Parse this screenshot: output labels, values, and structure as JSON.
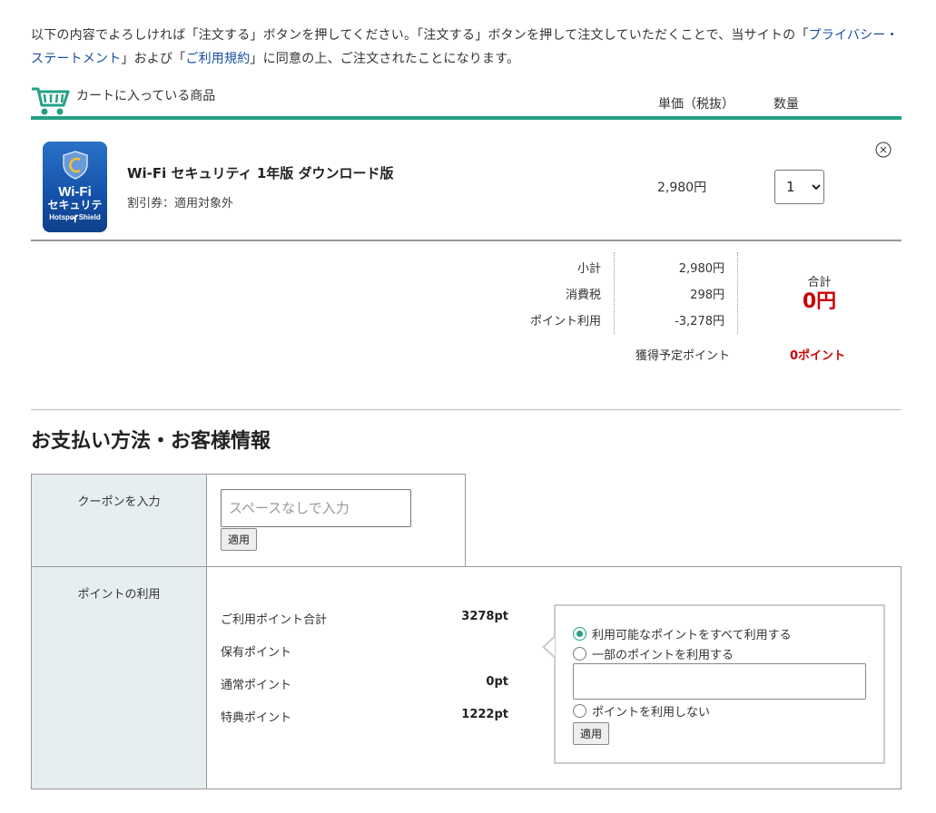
{
  "notice": {
    "part1": "以下の内容でよろしければ「注文する」ボタンを押してください。「注文する」ボタンを押して注文していただくことで、当サイトの",
    "bracket_open1": "「",
    "privacy_link": "プライバシー・ステートメント",
    "bracket_close1": "」および「",
    "terms_link": "ご利用規約",
    "part2": "」に同意の上、ご注文されたことになります。"
  },
  "cart": {
    "title": "カートに入っている商品",
    "col_price": "単価（税抜）",
    "col_qty": "数量",
    "accent_color": "#24a085"
  },
  "item": {
    "image_text1": "Wi-Fi",
    "image_text2": "セキュリティ",
    "image_text3": "Hotspot Shield",
    "name": "Wi-Fi セキュリティ 1年版 ダウンロード版",
    "coupon": "割引券：適用対象外",
    "price": "2,980円",
    "qty": "1"
  },
  "summary": {
    "subtotal_label": "小計",
    "subtotal_value": "2,980円",
    "tax_label": "消費税",
    "tax_value": "298円",
    "points_label": "ポイント利用",
    "points_value": "-3,278円",
    "total_label": "合計",
    "total_value": "0円",
    "earn_label": "獲得予定ポイント",
    "earn_value": "0ポイント",
    "highlight_color": "#cc0000"
  },
  "payment": {
    "title": "お支払い方法・お客様情報",
    "coupon_label": "クーポンを入力",
    "coupon_placeholder": "スペースなしで入力",
    "apply_label": "適用",
    "points_label": "ポイントの利用",
    "rows": [
      {
        "label": "ご利用ポイント合計",
        "value": "3278pt"
      },
      {
        "label": "保有ポイント",
        "value": ""
      },
      {
        "label": "通常ポイント",
        "value": "0pt"
      },
      {
        "label": "特典ポイント",
        "value": "1222pt"
      }
    ],
    "options": {
      "all": "利用可能なポイントをすべて利用する",
      "partial": "一部のポイントを利用する",
      "none": "ポイントを利用しない"
    },
    "apply_label2": "適用"
  }
}
